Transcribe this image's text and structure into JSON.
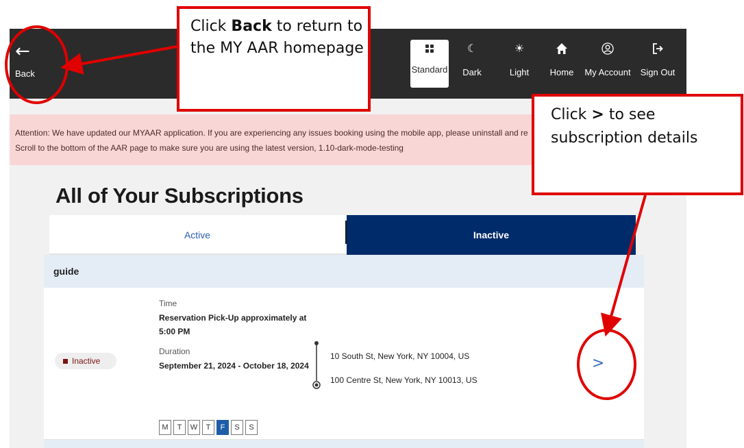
{
  "header": {
    "back_label": "Back",
    "nav": [
      {
        "label": "Standard",
        "icon": "grid-icon",
        "selected": true
      },
      {
        "label": "Dark",
        "icon": "moon-icon"
      },
      {
        "label": "Light",
        "icon": "sun-icon"
      },
      {
        "label": "Home",
        "icon": "home-icon"
      },
      {
        "label": "My Account",
        "icon": "user-circle-icon"
      },
      {
        "label": "Sign Out",
        "icon": "sign-out-icon"
      }
    ]
  },
  "attention": {
    "line1": "Attention: We have updated our MYAAR application. If you are experiencing any issues booking using the mobile app, please uninstall and re",
    "line2": "Scroll to the bottom of the AAR page to make sure you are using the latest version, 1.10-dark-mode-testing"
  },
  "page_title": "All of Your Subscriptions",
  "tabs": {
    "active": "Active",
    "inactive": "Inactive",
    "selected": "Inactive"
  },
  "group": {
    "title": "guide"
  },
  "subscription": {
    "status": "Inactive",
    "time_label": "Time",
    "time_value": "Reservation Pick-Up approximately at 5:00 PM",
    "duration_label": "Duration",
    "duration_value": "September 21, 2024 - October 18, 2024",
    "days": [
      "M",
      "T",
      "W",
      "T",
      "F",
      "S",
      "S"
    ],
    "selected_day": "F",
    "pickup_address": "10 South St, New York, NY 10004, US",
    "dropoff_address": "100 Centre St, New York, NY 10013, US",
    "chevron": ">"
  },
  "annotations": {
    "back_callout": {
      "pre": "Click ",
      "bold": "Back",
      "post": " to return to the MY AAR homepage"
    },
    "details_callout": {
      "pre": "Click ",
      "bold": ">",
      "post": " to see subscription details"
    }
  },
  "colors": {
    "accent_red": "#e00000",
    "navy": "#002b6a",
    "topbar": "#2b2b2b",
    "attention_bg": "#f8d6d6",
    "status_red": "#7a1212"
  }
}
